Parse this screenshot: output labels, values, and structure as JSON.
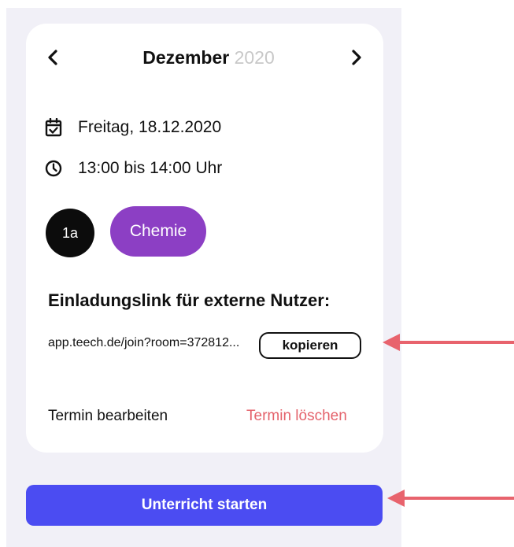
{
  "calendar": {
    "month": "Dezember",
    "year": "2020",
    "prev_icon": "chevron-left-icon",
    "next_icon": "chevron-right-icon"
  },
  "appointment": {
    "date_icon": "calendar-check-icon",
    "date": "Freitag, 18.12.2020",
    "time_icon": "clock-icon",
    "time": "13:00 bis 14:00 Uhr",
    "class_label": "1a",
    "subject_label": "Chemie"
  },
  "invite": {
    "heading": "Einladungslink für externe Nutzer:",
    "url": "app.teech.de/join?room=372812...",
    "copy_label": "kopieren"
  },
  "actions": {
    "edit_label": "Termin bearbeiten",
    "delete_label": "Termin löschen",
    "start_label": "Unterricht starten"
  },
  "colors": {
    "panel_bg": "#f1f0f7",
    "class_badge": "#0c0c0c",
    "subject_pill": "#8c3fc4",
    "delete": "#e4626b",
    "start_button": "#4b4cf2",
    "annotation_arrow": "#e8636d"
  }
}
